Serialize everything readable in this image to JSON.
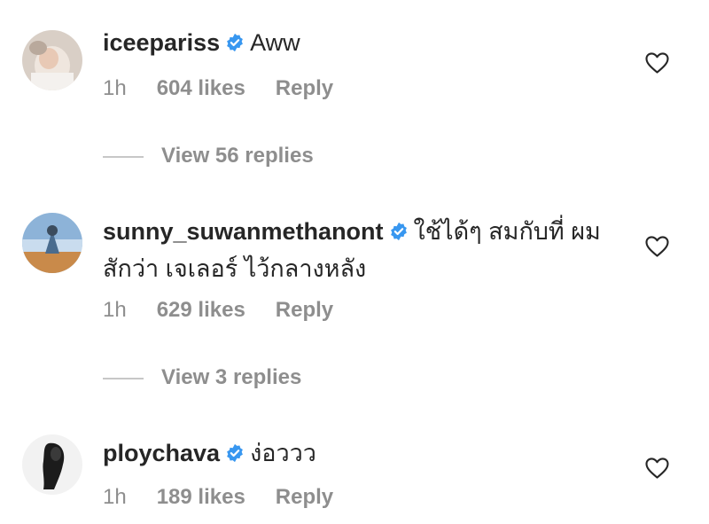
{
  "comments": [
    {
      "username": "iceepariss",
      "text": "Aww",
      "time": "1h",
      "likes": "604 likes",
      "reply": "Reply",
      "view_replies": "View 56 replies",
      "verified": true
    },
    {
      "username": "sunny_suwanmethanont",
      "text": "ใช้ได้ๆ สมกับที่ ผมสักว่า เจเลอร์ ไว้กลางหลัง",
      "time": "1h",
      "likes": "629 likes",
      "reply": "Reply",
      "view_replies": "View 3 replies",
      "verified": true
    },
    {
      "username": "ploychava",
      "text": "ง่อววว",
      "time": "1h",
      "likes": "189 likes",
      "reply": "Reply",
      "verified": true
    }
  ],
  "colors": {
    "text": "#262626",
    "muted": "#8e8e8e",
    "verified_badge": "#3897f0",
    "divider": "#c7c7c7"
  },
  "icons": {
    "verified": "verified-badge-icon",
    "like": "heart-outline-icon"
  }
}
